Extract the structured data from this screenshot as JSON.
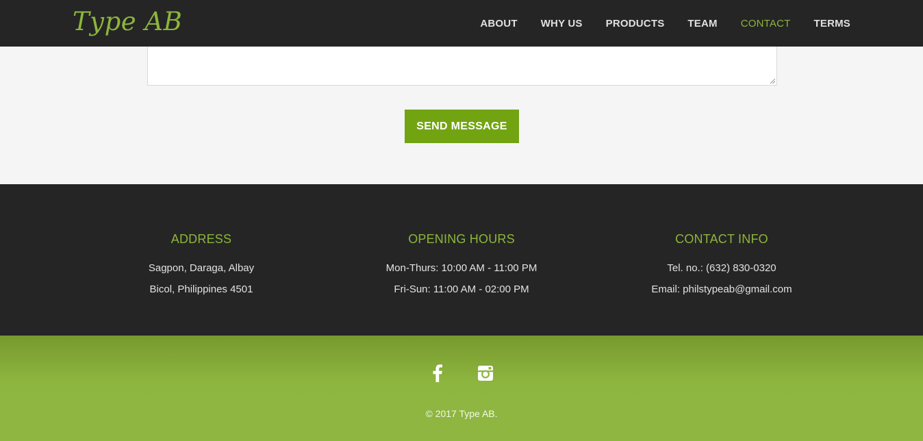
{
  "header": {
    "logo": "Type AB",
    "nav": [
      {
        "label": "ABOUT",
        "active": false
      },
      {
        "label": "WHY US",
        "active": false
      },
      {
        "label": "PRODUCTS",
        "active": false
      },
      {
        "label": "TEAM",
        "active": false
      },
      {
        "label": "CONTACT",
        "active": true
      },
      {
        "label": "TERMS",
        "active": false
      }
    ]
  },
  "form": {
    "message_value": "",
    "send_label": "SEND MESSAGE"
  },
  "info": {
    "address": {
      "title": "ADDRESS",
      "line1": "Sagpon, Daraga, Albay",
      "line2": "Bicol, Philippines 4501"
    },
    "hours": {
      "title": "OPENING HOURS",
      "line1": "Mon-Thurs: 10:00 AM - 11:00 PM",
      "line2": "Fri-Sun: 11:00 AM - 02:00 PM"
    },
    "contact": {
      "title": "CONTACT INFO",
      "line1": "Tel. no.: (632) 830-0320",
      "line2": "Email: philstypeab@gmail.com"
    }
  },
  "footer": {
    "social": [
      {
        "icon": "facebook-icon"
      },
      {
        "icon": "instagram-icon"
      }
    ],
    "copyright": "© 2017 Type AB."
  },
  "colors": {
    "accent": "#8db63b",
    "button": "#72a412",
    "dark": "#252525",
    "footer_green": "#8fb641"
  }
}
